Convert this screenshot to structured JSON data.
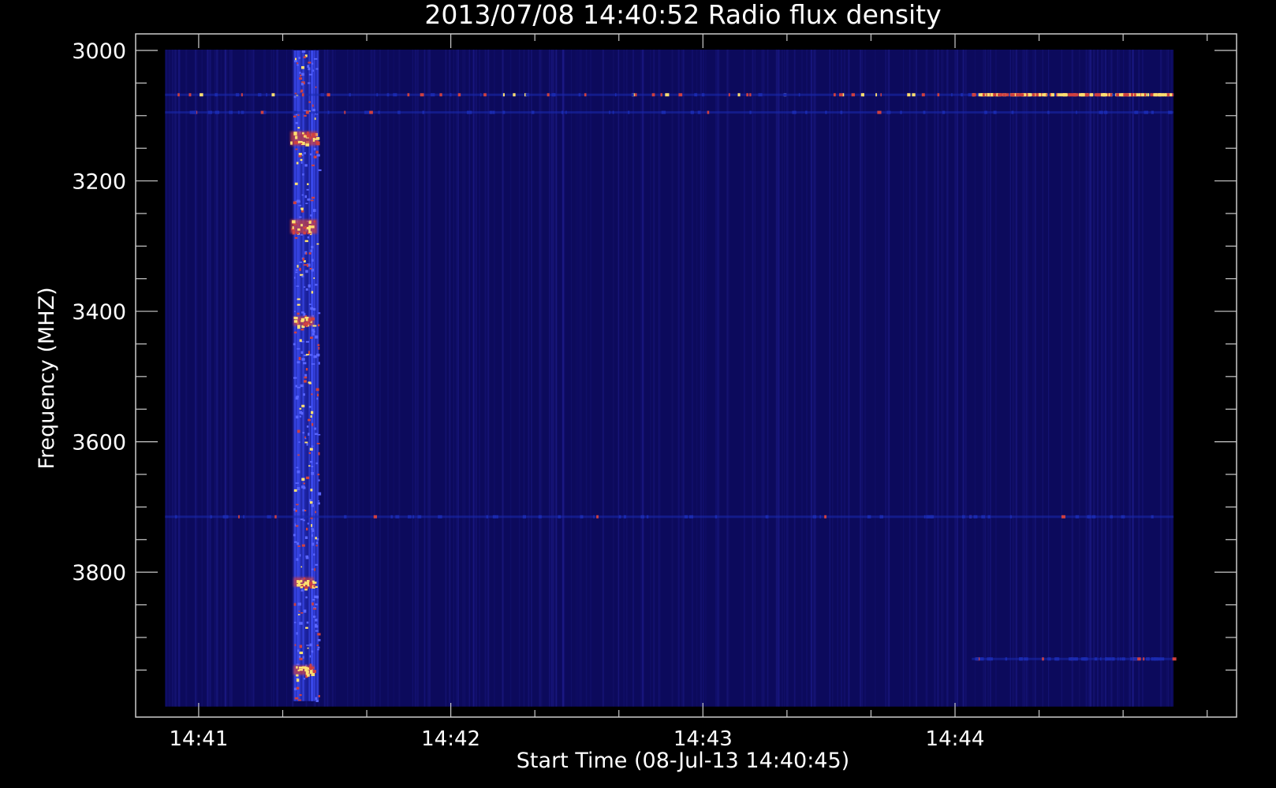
{
  "chart_data": {
    "type": "heatmap",
    "title": "2013/07/08 14:40:52 Radio flux density",
    "xlabel": "Start Time (08-Jul-13 14:40:45)",
    "ylabel": "Frequency (MHZ)",
    "x_time_range": [
      "14:40:45",
      "14:45:07"
    ],
    "data_time_range": [
      "14:40:52",
      "14:44:52"
    ],
    "xlim_seconds_after_start": [
      0,
      262
    ],
    "ylim": [
      3000,
      4000
    ],
    "y_inverted": true,
    "x_ticks": [
      {
        "label": "14:41",
        "t": 15
      },
      {
        "label": "14:42",
        "t": 75
      },
      {
        "label": "14:43",
        "t": 135
      },
      {
        "label": "14:44",
        "t": 195
      }
    ],
    "x_minor_tick_step_seconds": 20,
    "y_ticks": [
      {
        "label": "3000",
        "v": 3000
      },
      {
        "label": "3200",
        "v": 3200
      },
      {
        "label": "3400",
        "v": 3400
      },
      {
        "label": "3600",
        "v": 3600
      },
      {
        "label": "3800",
        "v": 3800
      }
    ],
    "y_minor_tick_step": 50,
    "grid": false,
    "colors": {
      "background": "#000000",
      "axes": "#cccccc",
      "heatmap_base": "#0c0a5c",
      "low": "#1a2ab0",
      "mid": "#d04040",
      "high": "#ffe070"
    },
    "features": [
      {
        "kind": "burst",
        "t_range": [
          37.5,
          43.5
        ],
        "freq_range": [
          3000,
          4000
        ],
        "intensity": "high"
      },
      {
        "kind": "band",
        "freq": 3068,
        "t_range": [
          7,
          247
        ],
        "intensity": "medium"
      },
      {
        "kind": "band",
        "freq": 3068,
        "t_range": [
          199,
          247
        ],
        "intensity": "high"
      },
      {
        "kind": "band",
        "freq": 3095,
        "t_range": [
          7,
          247
        ],
        "intensity": "low"
      },
      {
        "kind": "band",
        "freq": 3715,
        "t_range": [
          7,
          247
        ],
        "intensity": "low"
      },
      {
        "kind": "band",
        "freq": 3933,
        "t_range": [
          199,
          247
        ],
        "intensity": "low"
      },
      {
        "kind": "spot",
        "t": 40,
        "freq": 3270,
        "intensity": "high"
      },
      {
        "kind": "spot",
        "t": 40,
        "freq": 3135,
        "intensity": "high"
      },
      {
        "kind": "spot",
        "t": 40,
        "freq": 3415,
        "intensity": "medium"
      },
      {
        "kind": "spot",
        "t": 40,
        "freq": 3815,
        "intensity": "medium"
      },
      {
        "kind": "spot",
        "t": 40,
        "freq": 3950,
        "intensity": "medium"
      }
    ]
  }
}
